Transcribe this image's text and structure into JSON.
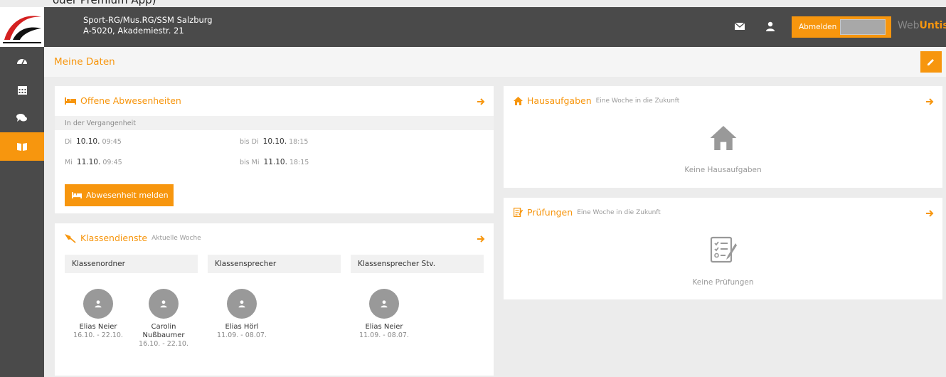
{
  "top_cut_text": "oder Premium App)",
  "school": {
    "name": "Sport-RG/Mus.RG/SSM Salzburg",
    "address": "A-5020, Akademiestr. 21"
  },
  "header": {
    "logout_label": "Abmelden",
    "brand_web": "Web",
    "brand_untis": "Untis"
  },
  "page": {
    "title": "Meine Daten"
  },
  "absences": {
    "title": "Offene Abwesenheiten",
    "section": "In der Vergangenheit",
    "rows": [
      {
        "start_day": "Di",
        "start_date": "10.10.",
        "start_time": "09:45",
        "end_prefix": "bis Di",
        "end_date": "10.10.",
        "end_time": "18:15"
      },
      {
        "start_day": "Mi",
        "start_date": "11.10.",
        "start_time": "09:45",
        "end_prefix": "bis Mi",
        "end_date": "11.10.",
        "end_time": "18:15"
      }
    ],
    "report_button": "Abwesenheit melden"
  },
  "duties": {
    "title": "Klassendienste",
    "subtitle": "Aktuelle Woche",
    "columns": [
      {
        "label": "Klassenordner",
        "people": [
          {
            "name": "Elias Neier",
            "dates": "16.10. - 22.10."
          },
          {
            "name": "Carolin Nußbaumer",
            "dates": "16.10. - 22.10."
          }
        ]
      },
      {
        "label": "Klassensprecher",
        "people": [
          {
            "name": "Elias Hörl",
            "dates": "11.09. - 08.07."
          }
        ]
      },
      {
        "label": "Klassensprecher Stv.",
        "people": [
          {
            "name": "Elias Neier",
            "dates": "11.09. - 08.07."
          }
        ]
      }
    ]
  },
  "homework": {
    "title": "Hausaufgaben",
    "subtitle": "Eine Woche in die Zukunft",
    "empty": "Keine Hausaufgaben"
  },
  "exams": {
    "title": "Prüfungen",
    "subtitle": "Eine Woche in die Zukunft",
    "empty": "Keine Prüfungen"
  },
  "colors": {
    "accent": "#f7960e",
    "topbar": "#4a4a4a",
    "background": "#ececec"
  }
}
